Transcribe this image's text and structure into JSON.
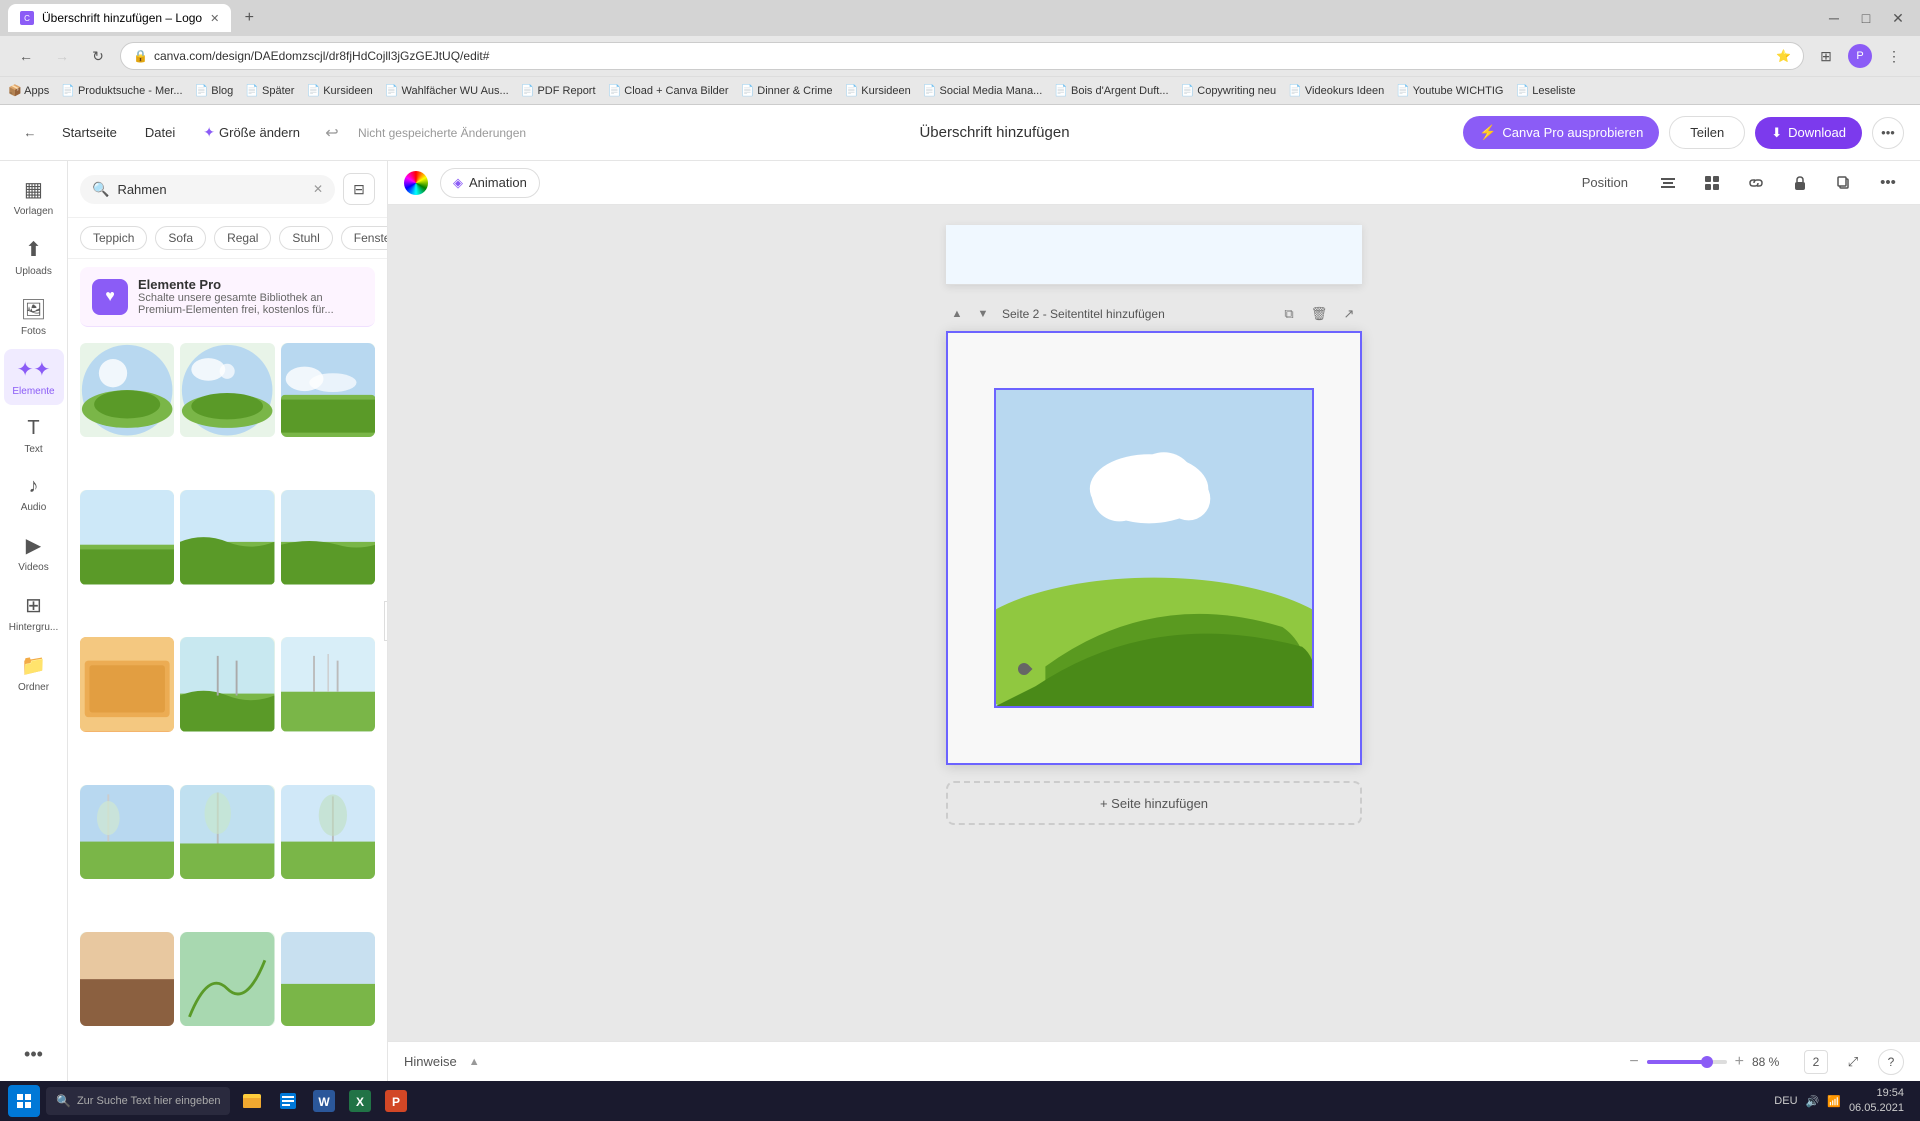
{
  "browser": {
    "tab_label": "Überschrift hinzufügen – Logo",
    "url": "canva.com/design/DAEdomzscjl/dr8fjHdCojll3jGzGEJtUQ/edit#",
    "bookmarks": [
      "Apps",
      "Produktsuche - Mer...",
      "Blog",
      "Später",
      "Kursideen",
      "Wahlfächer WU Aus...",
      "PDF Report",
      "Cload + Canva Bilder",
      "Dinner & Crime",
      "Kursideen",
      "Social Media Mana...",
      "Bois d'Argent Duft...",
      "Copywriting neu",
      "Videokurs Ideen",
      "Youtube WICHTIG",
      "Leseliste"
    ]
  },
  "toolbar": {
    "back_label": "Startseite",
    "file_label": "Datei",
    "size_label": "Größe ändern",
    "unsaved_label": "Nicht gespeicherte Änderungen",
    "title": "Überschrift hinzufügen",
    "canva_pro_label": "Canva Pro ausprobieren",
    "share_label": "Teilen",
    "download_label": "Download"
  },
  "sidebar": {
    "items": [
      {
        "label": "Vorlagen",
        "icon": "▦"
      },
      {
        "label": "Uploads",
        "icon": "⬆"
      },
      {
        "label": "Fotos",
        "icon": "🖼"
      },
      {
        "label": "Elemente",
        "icon": "✦"
      },
      {
        "label": "Text",
        "icon": "T"
      },
      {
        "label": "Audio",
        "icon": "♪"
      },
      {
        "label": "Videos",
        "icon": "▶"
      },
      {
        "label": "Hintergru...",
        "icon": "⊞"
      },
      {
        "label": "Ordner",
        "icon": "📁"
      }
    ]
  },
  "panel": {
    "search_placeholder": "Rahmen",
    "tags": [
      "Teppich",
      "Sofa",
      "Regal",
      "Stuhl",
      "Fenster"
    ],
    "pro_banner": {
      "title": "Elemente Pro",
      "desc": "Schalte unsere gesamte Bibliothek an Premium-Elementen frei, kostenlos für..."
    }
  },
  "canvas": {
    "animation_label": "Animation",
    "position_label": "Position",
    "page2_label": "Seite 2 - Seitentitel hinzufügen",
    "add_page_label": "+ Seite hinzufügen"
  },
  "bottom_bar": {
    "notes_label": "Hinweise",
    "zoom_value": "88 %",
    "page_num": "2"
  },
  "taskbar": {
    "search_placeholder": "Zur Suche Text hier eingeben",
    "time": "19:54",
    "date": "06.05.2021",
    "lang": "DEU"
  }
}
